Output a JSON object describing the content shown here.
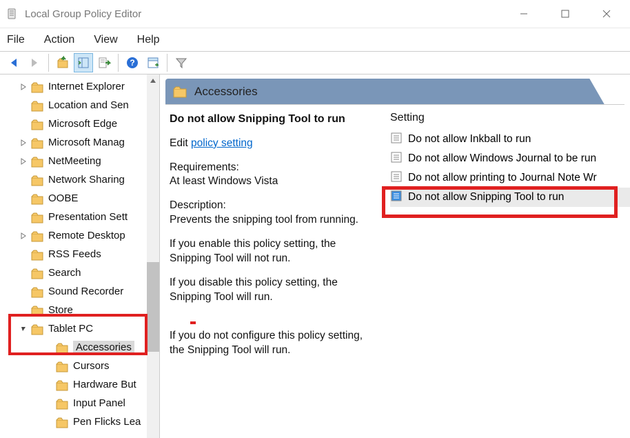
{
  "window": {
    "title": "Local Group Policy Editor"
  },
  "menu": {
    "file": "File",
    "action": "Action",
    "view": "View",
    "help": "Help"
  },
  "tree": {
    "items": [
      {
        "label": "Internet Explorer",
        "depth": 1,
        "expander": "closed"
      },
      {
        "label": "Location and Sen",
        "depth": 1,
        "expander": "none"
      },
      {
        "label": "Microsoft Edge",
        "depth": 1,
        "expander": "none"
      },
      {
        "label": "Microsoft Manag",
        "depth": 1,
        "expander": "closed"
      },
      {
        "label": "NetMeeting",
        "depth": 1,
        "expander": "closed"
      },
      {
        "label": "Network Sharing",
        "depth": 1,
        "expander": "none"
      },
      {
        "label": "OOBE",
        "depth": 1,
        "expander": "none"
      },
      {
        "label": "Presentation Sett",
        "depth": 1,
        "expander": "none"
      },
      {
        "label": "Remote Desktop",
        "depth": 1,
        "expander": "closed"
      },
      {
        "label": "RSS Feeds",
        "depth": 1,
        "expander": "none"
      },
      {
        "label": "Search",
        "depth": 1,
        "expander": "none"
      },
      {
        "label": "Sound Recorder",
        "depth": 1,
        "expander": "none"
      },
      {
        "label": "Store",
        "depth": 1,
        "expander": "none"
      },
      {
        "label": "Tablet PC",
        "depth": 1,
        "expander": "open"
      },
      {
        "label": "Accessories",
        "depth": 2,
        "expander": "none",
        "selected": true
      },
      {
        "label": "Cursors",
        "depth": 2,
        "expander": "none"
      },
      {
        "label": "Hardware But",
        "depth": 2,
        "expander": "none"
      },
      {
        "label": "Input Panel",
        "depth": 2,
        "expander": "none"
      },
      {
        "label": "Pen Flicks Lea",
        "depth": 2,
        "expander": "none"
      }
    ],
    "scroll_up": "^"
  },
  "header": {
    "label": "Accessories"
  },
  "detail": {
    "name": "Do not allow Snipping Tool to run",
    "edit_prefix": "Edit",
    "edit_link": "policy setting",
    "req_label": "Requirements:",
    "req_value": "At least Windows Vista",
    "desc_label": "Description:",
    "desc_1": "Prevents the snipping tool from running.",
    "desc_2": "If you enable this policy setting, the Snipping Tool will not run.",
    "desc_3": "If you disable this policy setting, the Snipping Tool will run.",
    "desc_4": "If you do not configure this policy setting, the Snipping Tool will run."
  },
  "settings_header": "Setting",
  "settings": [
    {
      "label": "Do not allow Inkball to run"
    },
    {
      "label": "Do not allow Windows Journal to be run"
    },
    {
      "label": "Do not allow printing to Journal Note Wr"
    },
    {
      "label": "Do not allow Snipping Tool to run",
      "selected": true
    }
  ]
}
